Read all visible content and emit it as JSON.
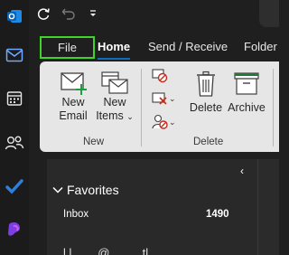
{
  "tabs": {
    "file": "File",
    "home": "Home",
    "send_receive": "Send / Receive",
    "folder": "Folder"
  },
  "ribbon": {
    "new_email": "New\nEmail",
    "new_email_l1": "New",
    "new_email_l2": "Email",
    "new_items_l1": "New",
    "new_items_l2": "Items",
    "new_items_chevron": "⌄",
    "delete": "Delete",
    "archive": "Archive",
    "group_new": "New",
    "group_delete": "Delete"
  },
  "pane": {
    "collapse_glyph": "‹",
    "favorites": "Favorites",
    "inbox": "Inbox",
    "inbox_count": "1490",
    "account_partial": "l.l........@..........tl...."
  },
  "colors": {
    "file_highlight": "#3fd42a",
    "accent": "#0f6cbd",
    "todo": "#2b7fe0",
    "copilot": "#7b3fe4"
  }
}
